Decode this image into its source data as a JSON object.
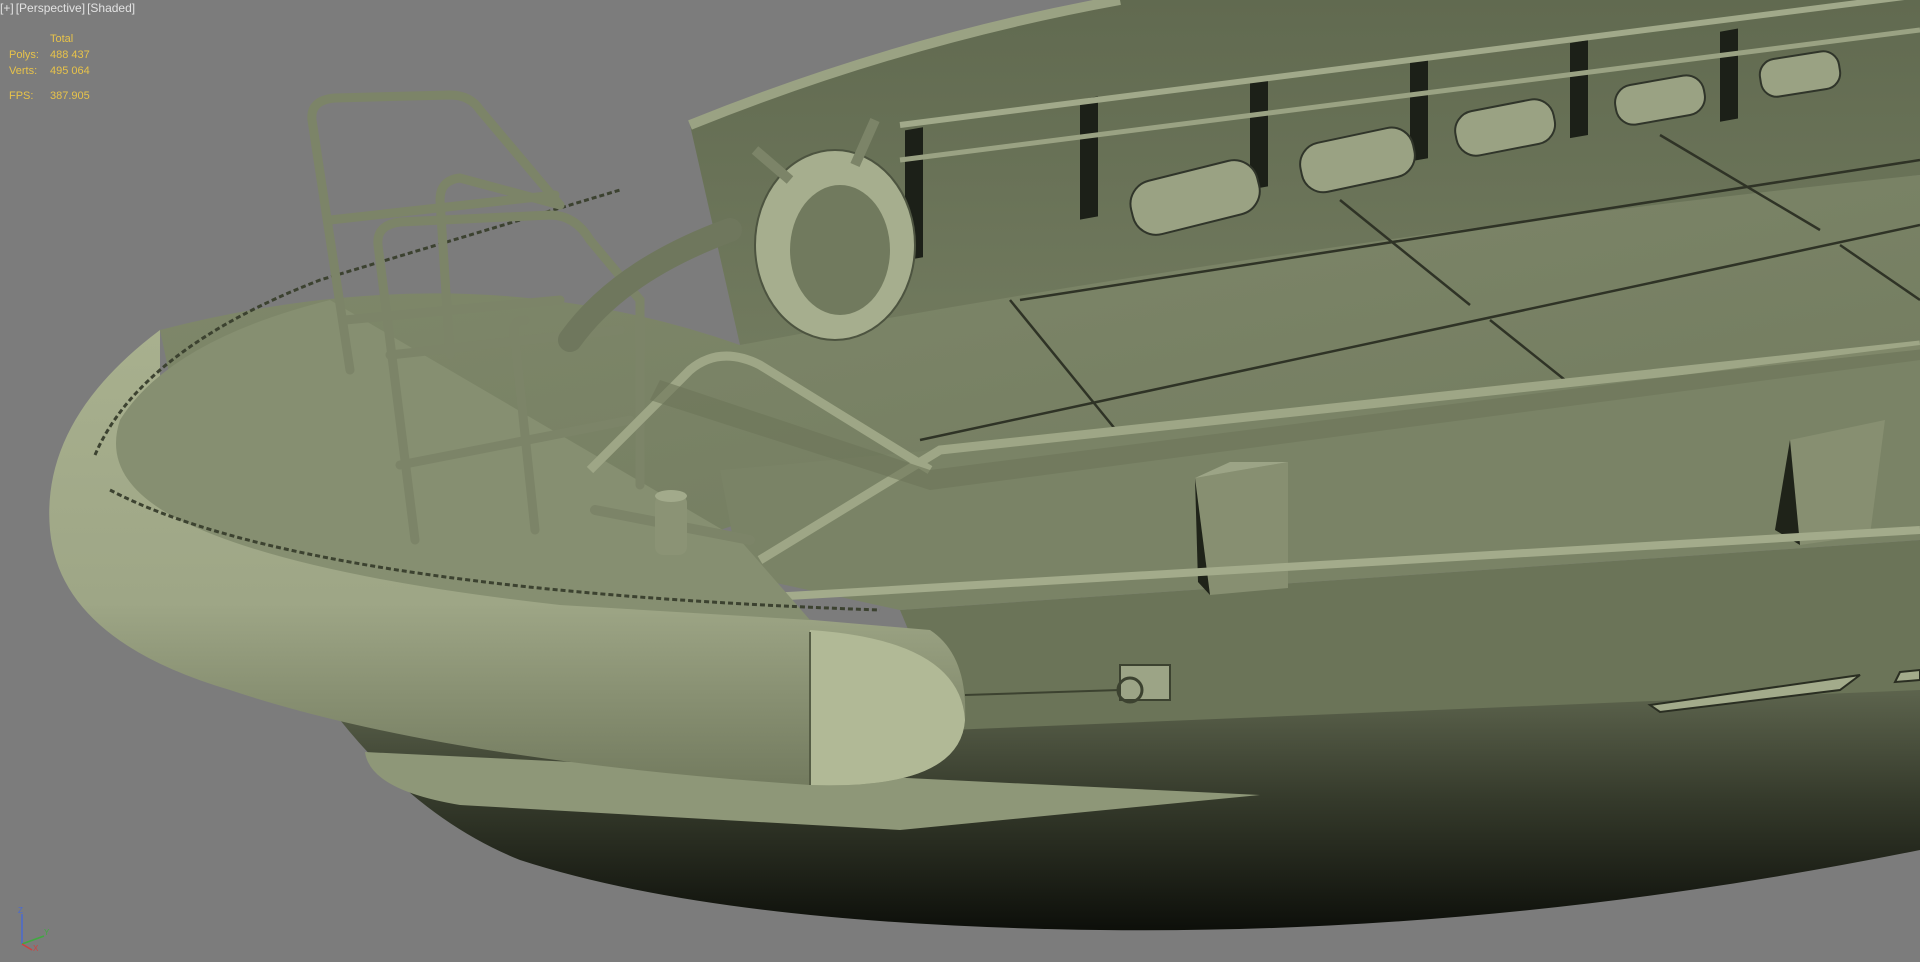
{
  "viewport": {
    "menu_button": "[+]",
    "view_mode": "[Perspective]",
    "shading_mode": "[Shaded]"
  },
  "stats": {
    "header": "Total",
    "polys_label": "Polys:",
    "polys_value": "488 437",
    "verts_label": "Verts:",
    "verts_value": "495 064",
    "fps_label": "FPS:",
    "fps_value": "387.905"
  },
  "axis_gizmo": {
    "z": "Z",
    "y": "Y",
    "x": "X"
  },
  "colors": {
    "background": "#7c7c7c",
    "model": "#7d866a",
    "stats_text": "#e8c34a",
    "label_text": "#e2e2e2"
  }
}
